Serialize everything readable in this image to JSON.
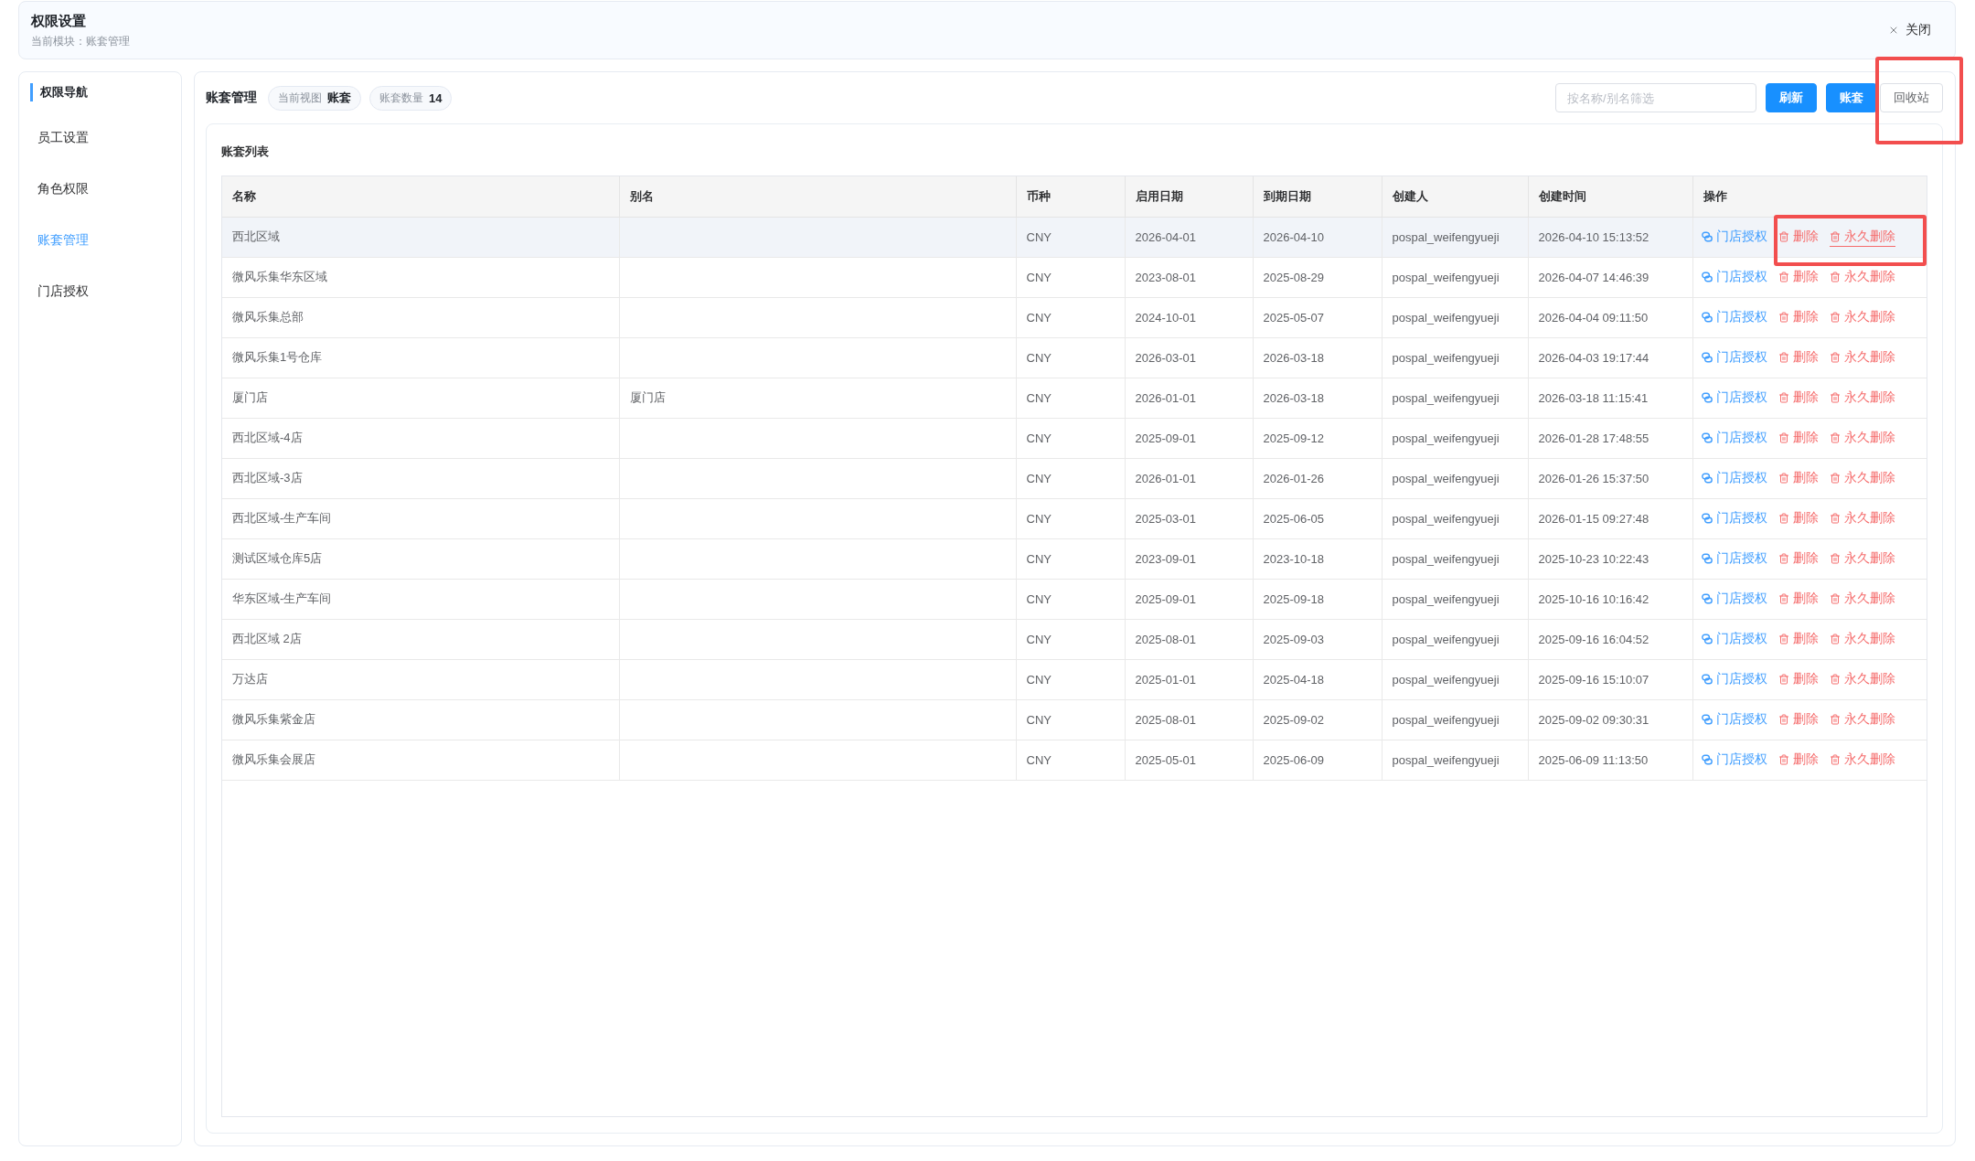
{
  "header": {
    "title": "权限设置",
    "subtitle": "当前模块：账套管理",
    "close_label": "关闭"
  },
  "sidebar": {
    "heading": "权限导航",
    "items": [
      {
        "label": "员工设置",
        "selected": false
      },
      {
        "label": "角色权限",
        "selected": false
      },
      {
        "label": "账套管理",
        "selected": true
      },
      {
        "label": "门店授权",
        "selected": false
      }
    ]
  },
  "toolbar": {
    "title": "账套管理",
    "chips": [
      {
        "label": "当前视图",
        "value": "账套"
      },
      {
        "label": "账套数量",
        "value": "14"
      }
    ],
    "search": {
      "placeholder": "按名称/别名筛选"
    },
    "buttons": [
      {
        "kind": "primary",
        "label": "刷新",
        "annotated": false
      },
      {
        "kind": "primary",
        "label": "账套",
        "annotated": false
      },
      {
        "kind": "default",
        "label": "回收站",
        "annotated": true
      }
    ]
  },
  "table": {
    "title": "账套列表",
    "columns": [
      "名称",
      "别名",
      "币种",
      "启用日期",
      "到期日期",
      "创建人",
      "创建时间",
      "操作"
    ],
    "rows": [
      {
        "name": "西北区域",
        "currency": "CNY",
        "start_date": "2026-04-01",
        "end_date": "2026-04-10",
        "creator": "pospal_weifengyueji",
        "created_at": "2026-04-10 15:13:52",
        "hovered": true,
        "annotated": true,
        "actions": [
          {
            "kind": "authorize",
            "label": "门店授权",
            "hovered": false
          },
          {
            "kind": "delete",
            "label": "删除",
            "hovered": false
          },
          {
            "kind": "purge",
            "label": "永久删除",
            "hovered": true
          }
        ]
      },
      {
        "name": "微风乐集华东区域",
        "currency": "CNY",
        "start_date": "2023-08-01",
        "end_date": "2025-08-29",
        "creator": "pospal_weifengyueji",
        "created_at": "2026-04-07 14:46:39",
        "hovered": false,
        "annotated": false,
        "actions": [
          {
            "kind": "authorize",
            "label": "门店授权",
            "hovered": false
          },
          {
            "kind": "delete",
            "label": "删除",
            "hovered": false
          },
          {
            "kind": "purge",
            "label": "永久删除",
            "hovered": false
          }
        ]
      },
      {
        "name": "微风乐集总部",
        "currency": "CNY",
        "start_date": "2024-10-01",
        "end_date": "2025-05-07",
        "creator": "pospal_weifengyueji",
        "created_at": "2026-04-04 09:11:50",
        "hovered": false,
        "annotated": false,
        "actions": [
          {
            "kind": "authorize",
            "label": "门店授权",
            "hovered": false
          },
          {
            "kind": "delete",
            "label": "删除",
            "hovered": false
          },
          {
            "kind": "purge",
            "label": "永久删除",
            "hovered": false
          }
        ]
      },
      {
        "name": "微风乐集1号仓库",
        "currency": "CNY",
        "start_date": "2026-03-01",
        "end_date": "2026-03-18",
        "creator": "pospal_weifengyueji",
        "created_at": "2026-04-03 19:17:44",
        "hovered": false,
        "annotated": false,
        "actions": [
          {
            "kind": "authorize",
            "label": "门店授权",
            "hovered": false
          },
          {
            "kind": "delete",
            "label": "删除",
            "hovered": false
          },
          {
            "kind": "purge",
            "label": "永久删除",
            "hovered": false
          }
        ]
      },
      {
        "name": "厦门店",
        "alias": "厦门店",
        "currency": "CNY",
        "start_date": "2026-01-01",
        "end_date": "2026-03-18",
        "creator": "pospal_weifengyueji",
        "created_at": "2026-03-18 11:15:41",
        "hovered": false,
        "annotated": false,
        "actions": [
          {
            "kind": "authorize",
            "label": "门店授权",
            "hovered": false
          },
          {
            "kind": "delete",
            "label": "删除",
            "hovered": false
          },
          {
            "kind": "purge",
            "label": "永久删除",
            "hovered": false
          }
        ]
      },
      {
        "name": "西北区域-4店",
        "currency": "CNY",
        "start_date": "2025-09-01",
        "end_date": "2025-09-12",
        "creator": "pospal_weifengyueji",
        "created_at": "2026-01-28 17:48:55",
        "hovered": false,
        "annotated": false,
        "actions": [
          {
            "kind": "authorize",
            "label": "门店授权",
            "hovered": false
          },
          {
            "kind": "delete",
            "label": "删除",
            "hovered": false
          },
          {
            "kind": "purge",
            "label": "永久删除",
            "hovered": false
          }
        ]
      },
      {
        "name": "西北区域-3店",
        "currency": "CNY",
        "start_date": "2026-01-01",
        "end_date": "2026-01-26",
        "creator": "pospal_weifengyueji",
        "created_at": "2026-01-26 15:37:50",
        "hovered": false,
        "annotated": false,
        "actions": [
          {
            "kind": "authorize",
            "label": "门店授权",
            "hovered": false
          },
          {
            "kind": "delete",
            "label": "删除",
            "hovered": false
          },
          {
            "kind": "purge",
            "label": "永久删除",
            "hovered": false
          }
        ]
      },
      {
        "name": "西北区域-生产车间",
        "currency": "CNY",
        "start_date": "2025-03-01",
        "end_date": "2025-06-05",
        "creator": "pospal_weifengyueji",
        "created_at": "2026-01-15 09:27:48",
        "hovered": false,
        "annotated": false,
        "actions": [
          {
            "kind": "authorize",
            "label": "门店授权",
            "hovered": false
          },
          {
            "kind": "delete",
            "label": "删除",
            "hovered": false
          },
          {
            "kind": "purge",
            "label": "永久删除",
            "hovered": false
          }
        ]
      },
      {
        "name": "测试区域仓库5店",
        "currency": "CNY",
        "start_date": "2023-09-01",
        "end_date": "2023-10-18",
        "creator": "pospal_weifengyueji",
        "created_at": "2025-10-23 10:22:43",
        "hovered": false,
        "annotated": false,
        "actions": [
          {
            "kind": "authorize",
            "label": "门店授权",
            "hovered": false
          },
          {
            "kind": "delete",
            "label": "删除",
            "hovered": false
          },
          {
            "kind": "purge",
            "label": "永久删除",
            "hovered": false
          }
        ]
      },
      {
        "name": "华东区域-生产车间",
        "currency": "CNY",
        "start_date": "2025-09-01",
        "end_date": "2025-09-18",
        "creator": "pospal_weifengyueji",
        "created_at": "2025-10-16 10:16:42",
        "hovered": false,
        "annotated": false,
        "actions": [
          {
            "kind": "authorize",
            "label": "门店授权",
            "hovered": false
          },
          {
            "kind": "delete",
            "label": "删除",
            "hovered": false
          },
          {
            "kind": "purge",
            "label": "永久删除",
            "hovered": false
          }
        ]
      },
      {
        "name": "西北区域 2店",
        "currency": "CNY",
        "start_date": "2025-08-01",
        "end_date": "2025-09-03",
        "creator": "pospal_weifengyueji",
        "created_at": "2025-09-16 16:04:52",
        "hovered": false,
        "annotated": false,
        "actions": [
          {
            "kind": "authorize",
            "label": "门店授权",
            "hovered": false
          },
          {
            "kind": "delete",
            "label": "删除",
            "hovered": false
          },
          {
            "kind": "purge",
            "label": "永久删除",
            "hovered": false
          }
        ]
      },
      {
        "name": "万达店",
        "currency": "CNY",
        "start_date": "2025-01-01",
        "end_date": "2025-04-18",
        "creator": "pospal_weifengyueji",
        "created_at": "2025-09-16 15:10:07",
        "hovered": false,
        "annotated": false,
        "actions": [
          {
            "kind": "authorize",
            "label": "门店授权",
            "hovered": false
          },
          {
            "kind": "delete",
            "label": "删除",
            "hovered": false
          },
          {
            "kind": "purge",
            "label": "永久删除",
            "hovered": false
          }
        ]
      },
      {
        "name": "微风乐集紫金店",
        "currency": "CNY",
        "start_date": "2025-08-01",
        "end_date": "2025-09-02",
        "creator": "pospal_weifengyueji",
        "created_at": "2025-09-02 09:30:31",
        "hovered": false,
        "annotated": false,
        "actions": [
          {
            "kind": "authorize",
            "label": "门店授权",
            "hovered": false
          },
          {
            "kind": "delete",
            "label": "删除",
            "hovered": false
          },
          {
            "kind": "purge",
            "label": "永久删除",
            "hovered": false
          }
        ]
      },
      {
        "name": "微风乐集会展店",
        "currency": "CNY",
        "start_date": "2025-05-01",
        "end_date": "2025-06-09",
        "creator": "pospal_weifengyueji",
        "created_at": "2025-06-09 11:13:50",
        "hovered": false,
        "annotated": false,
        "actions": [
          {
            "kind": "authorize",
            "label": "门店授权",
            "hovered": false
          },
          {
            "kind": "delete",
            "label": "删除",
            "hovered": false
          },
          {
            "kind": "purge",
            "label": "永久删除",
            "hovered": false
          }
        ]
      }
    ]
  }
}
